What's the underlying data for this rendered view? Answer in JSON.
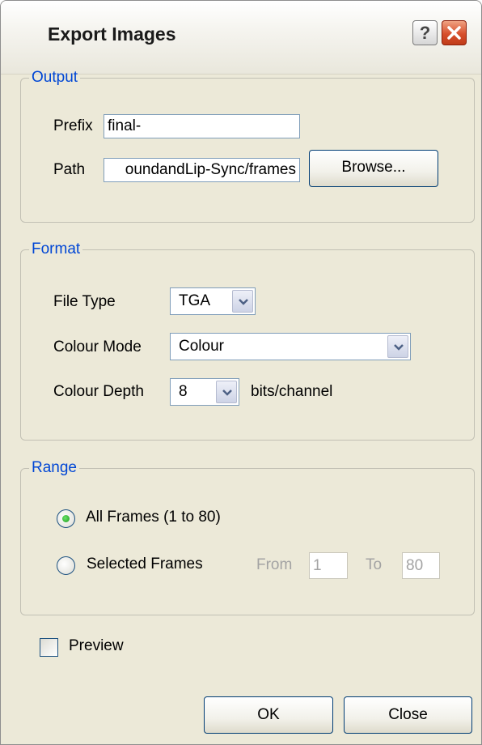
{
  "window": {
    "title": "Export Images",
    "help_glyph": "?",
    "close_glyph": "X"
  },
  "output": {
    "legend": "Output",
    "prefix_label": "Prefix",
    "prefix_value": "final-",
    "path_label": "Path",
    "path_value": "oundandLip-Sync/frames",
    "browse_label": "Browse..."
  },
  "format": {
    "legend": "Format",
    "file_type_label": "File Type",
    "file_type_value": "TGA",
    "colour_mode_label": "Colour Mode",
    "colour_mode_value": "Colour",
    "colour_depth_label": "Colour Depth",
    "colour_depth_value": "8",
    "bits_label": "bits/channel"
  },
  "range": {
    "legend": "Range",
    "all_frames_label": "All Frames (1 to 80)",
    "all_frames_selected": true,
    "selected_frames_label": "Selected Frames",
    "from_label": "From",
    "from_value": "1",
    "to_label": "To",
    "to_value": "80"
  },
  "preview": {
    "label": "Preview",
    "checked": false
  },
  "buttons": {
    "ok": "OK",
    "close": "Close"
  },
  "colors": {
    "legend_blue": "#0046d5",
    "dialog_bg": "#ece9d8",
    "close_red": "#d74f2c"
  },
  "icons": {
    "help": "help-icon",
    "close": "close-icon",
    "dropdown": "chevron-down-icon"
  }
}
